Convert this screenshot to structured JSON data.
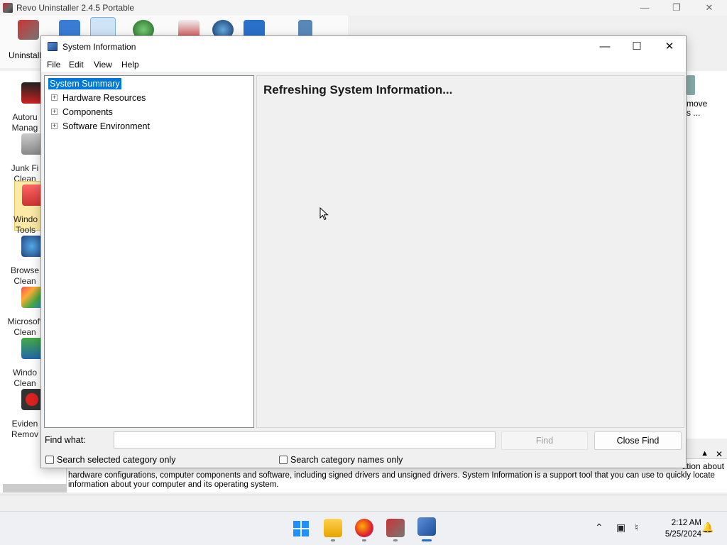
{
  "revo": {
    "title": "Revo Uninstaller 2.4.5 Portable",
    "ribbon_label": "Uninstall",
    "sidebar": [
      {
        "line1": "Autoru",
        "line2": "Manag"
      },
      {
        "line1": "Junk Fi",
        "line2": "Clean"
      },
      {
        "line1": "Windo",
        "line2": "Tools"
      },
      {
        "line1": "Browse",
        "line2": "Clean"
      },
      {
        "line1": "Microsoft",
        "line2": "Clean"
      },
      {
        "line1": "Windo",
        "line2": "Clean"
      },
      {
        "line1": "Eviden",
        "line2": "Remov"
      }
    ],
    "right_panel": {
      "line1": "move",
      "line2": "s ..."
    },
    "description_overflow": "ation about",
    "description": "hardware configurations, computer components and software, including signed drivers and unsigned drivers. System Information is a support tool that you can use to quickly locate information about your computer and its operating system."
  },
  "msinfo": {
    "title": "System Information",
    "menu": [
      "File",
      "Edit",
      "View",
      "Help"
    ],
    "tree": {
      "root": "System Summary",
      "children": [
        "Hardware Resources",
        "Components",
        "Software Environment"
      ]
    },
    "detail_message": "Refreshing System Information...",
    "find": {
      "label": "Find what:",
      "value": "",
      "find_button": "Find",
      "close_button": "Close Find",
      "check_selected": "Search selected category only",
      "check_names": "Search category names only"
    }
  },
  "taskbar": {
    "time": "2:12 AM",
    "date": "5/25/2024"
  }
}
